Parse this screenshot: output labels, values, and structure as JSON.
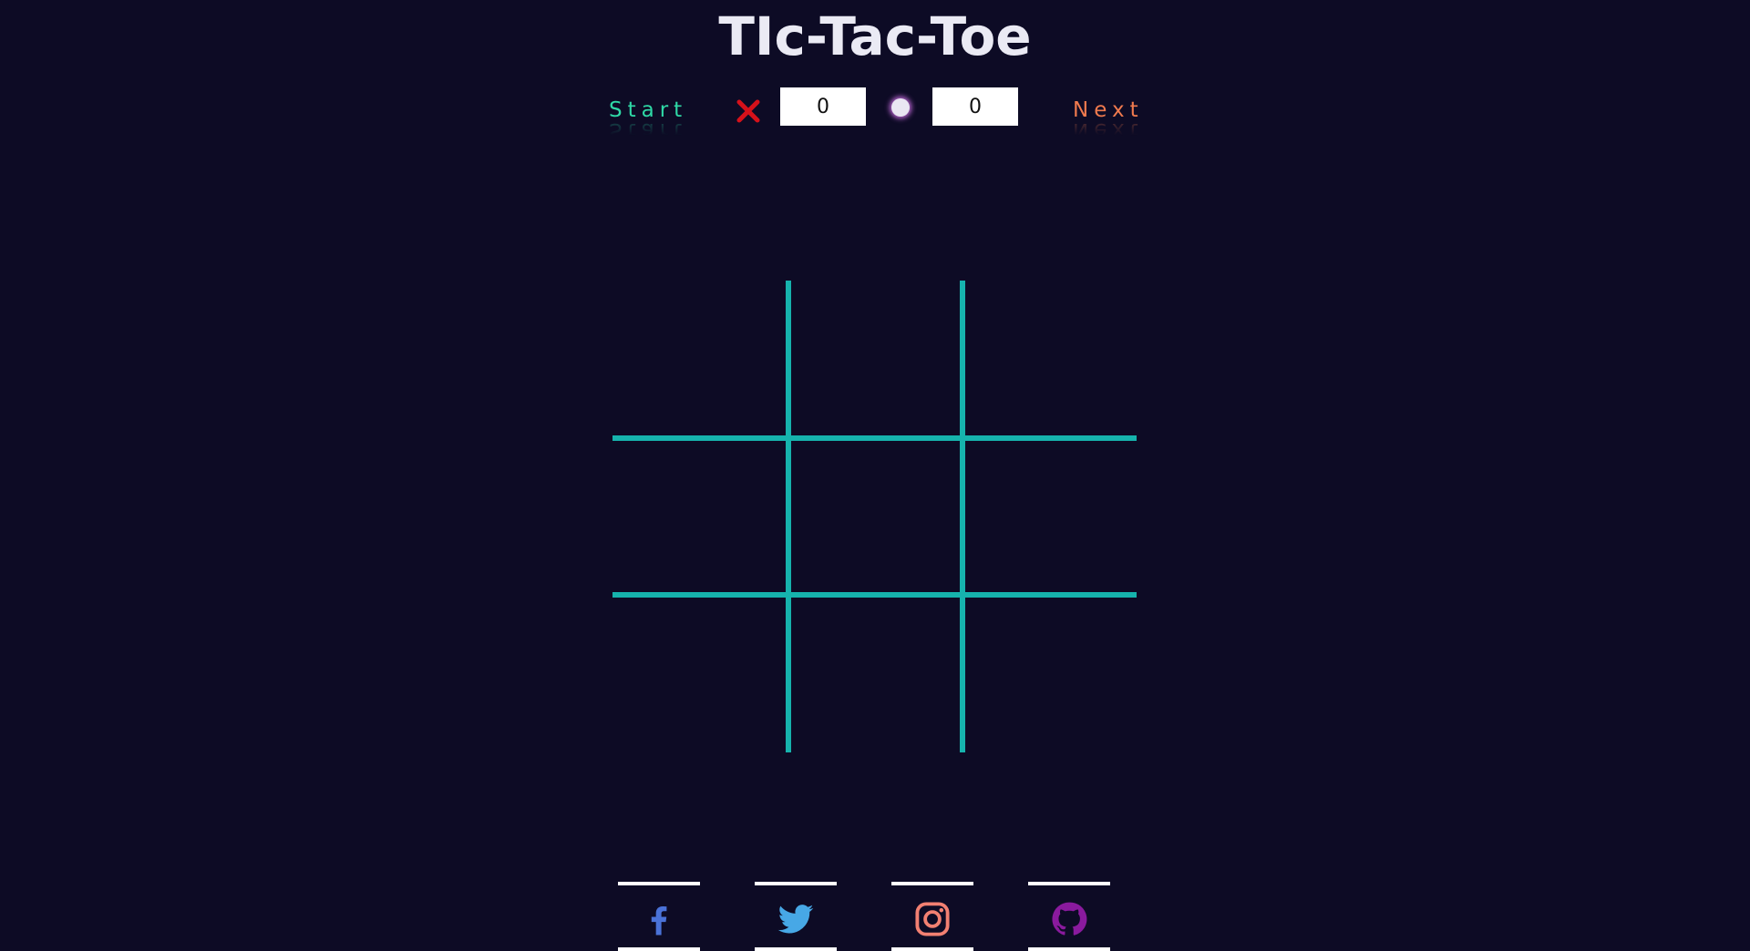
{
  "title": "TIc-Tac-Toe",
  "controls": {
    "start_label": "Start",
    "next_label": "Next",
    "x_score": "0",
    "o_score": "0"
  },
  "board": {
    "cells": [
      "",
      "",
      "",
      "",
      "",
      "",
      "",
      "",
      ""
    ],
    "grid_color": "#16b3ad"
  },
  "social": [
    {
      "name": "facebook-icon",
      "color": "#4a72d8"
    },
    {
      "name": "twitter-icon",
      "color": "#47a8e6"
    },
    {
      "name": "instagram-icon",
      "color": "#f28072"
    },
    {
      "name": "github-icon",
      "color": "#8a1a9e"
    }
  ],
  "colors": {
    "background": "#0d0b25",
    "start": "#2fd9a6",
    "next": "#f07a4e",
    "x_mark": "#d6111a"
  }
}
